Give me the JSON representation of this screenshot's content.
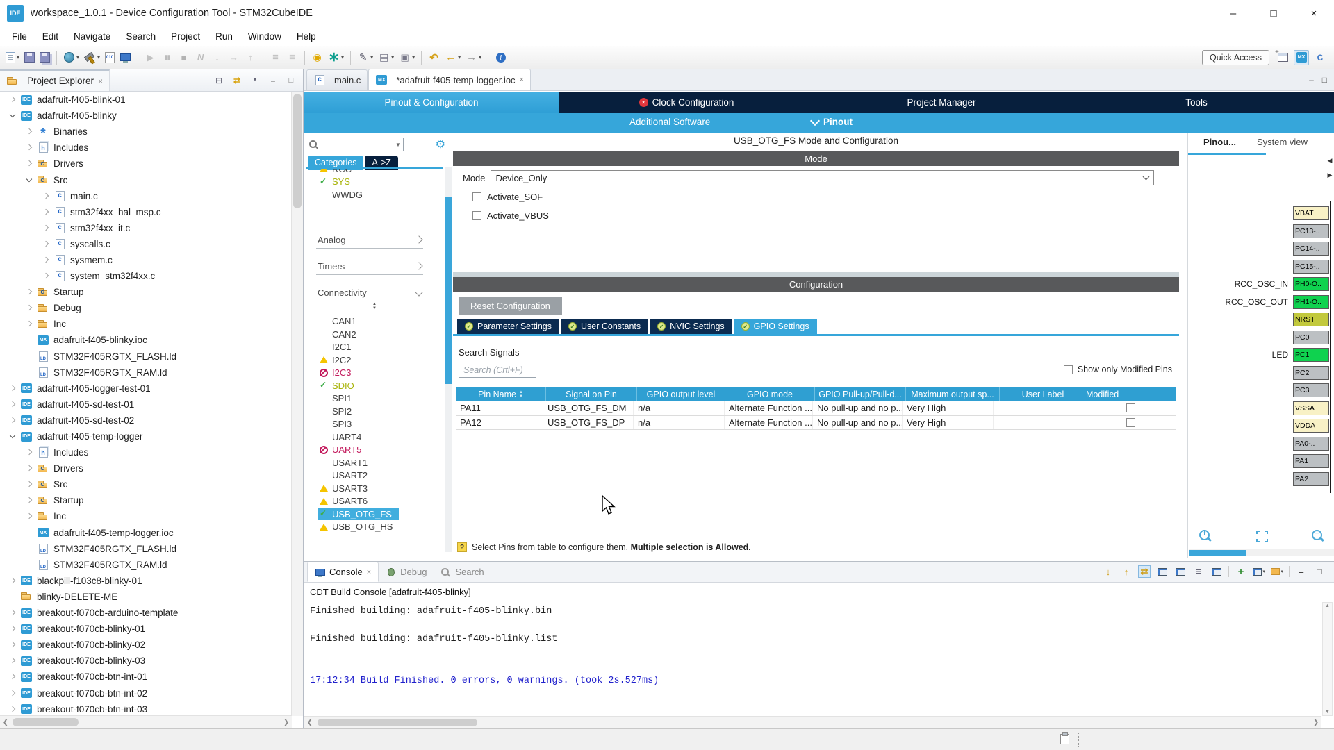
{
  "palette": {
    "accent": "#36a6da",
    "navy": "#071f3d",
    "section_header_gray": "#58595b",
    "table_header_blue": "#2f9fd2",
    "check_green": "#3fae49",
    "warning_yellow": "#f5c400",
    "blocked_pink": "#c2185b",
    "olive_enabled": "#a9b40a",
    "console_info_blue": "#2121cc",
    "pin_active_green": "#0fd24f",
    "pin_io_gray": "#bcc0c3",
    "pin_power_yellow": "#f8f1c6",
    "pin_reset_olive": "#c2c93d"
  },
  "window": {
    "title": "workspace_1.0.1 - Device Configuration Tool - STM32CubeIDE",
    "app_badge": "IDE",
    "controls": {
      "minimize": "–",
      "maximize": "□",
      "close": "×"
    }
  },
  "menu": {
    "items": [
      "File",
      "Edit",
      "Navigate",
      "Search",
      "Project",
      "Run",
      "Window",
      "Help"
    ]
  },
  "toolbar": {
    "quick_access": "Quick Access",
    "icons": [
      {
        "name": "new-wizard",
        "kind": "page",
        "dropdown": true
      },
      {
        "name": "save",
        "kind": "floppy"
      },
      {
        "name": "save-all",
        "kind": "floppy2"
      },
      {
        "kind": "sep"
      },
      {
        "name": "skip-all-breakpoints",
        "kind": "circle",
        "dropdown": true
      },
      {
        "name": "build-all",
        "kind": "hammer",
        "dropdown": true
      },
      {
        "name": "build-binary",
        "kind": "binary"
      },
      {
        "name": "open-console",
        "kind": "monitor"
      },
      {
        "kind": "sep"
      },
      {
        "name": "resume",
        "kind": "play",
        "disabled": true
      },
      {
        "name": "suspend",
        "kind": "pause",
        "disabled": true
      },
      {
        "name": "terminate",
        "kind": "stop",
        "disabled": true
      },
      {
        "name": "disconnect",
        "kind": "disconnect",
        "disabled": true
      },
      {
        "name": "step-into",
        "kind": "stepinto",
        "disabled": true
      },
      {
        "name": "step-over",
        "kind": "stepover",
        "disabled": true
      },
      {
        "name": "step-return",
        "kind": "stepreturn",
        "disabled": true
      },
      {
        "kind": "sep"
      },
      {
        "name": "instruction-stepping",
        "kind": "lines",
        "disabled": true
      },
      {
        "name": "use-step-filters",
        "kind": "lines2",
        "disabled": true
      },
      {
        "kind": "sep"
      },
      {
        "name": "update-index",
        "kind": "hand"
      },
      {
        "name": "new-launch-configuration",
        "kind": "star",
        "dropdown": true
      },
      {
        "kind": "sep"
      },
      {
        "name": "debug-tool",
        "kind": "pencil",
        "dropdown": true
      },
      {
        "name": "run-tool",
        "kind": "grid",
        "dropdown": true
      },
      {
        "name": "external-tools",
        "kind": "runext",
        "dropdown": true
      },
      {
        "kind": "sep"
      },
      {
        "name": "last-edit-location",
        "kind": "backedit"
      },
      {
        "name": "back-history",
        "kind": "back",
        "dropdown": true
      },
      {
        "name": "forward-history",
        "kind": "fwd",
        "dropdown": true
      },
      {
        "kind": "sep"
      },
      {
        "name": "help-info",
        "kind": "info"
      }
    ],
    "perspectives": [
      {
        "name": "open-perspective",
        "kind": "persp"
      },
      {
        "name": "cubemx-perspective",
        "kind": "mxp",
        "active": true
      },
      {
        "name": "cpp-perspective",
        "kind": "cpp"
      }
    ]
  },
  "explorer": {
    "title": "Project Explorer",
    "header_icons": [
      {
        "name": "collapse-all",
        "kind": "collapse"
      },
      {
        "name": "link-with-editor",
        "kind": "link"
      },
      {
        "name": "view-menu",
        "kind": "menu"
      },
      {
        "name": "minimize-view",
        "kind": "min"
      },
      {
        "name": "maximize-view",
        "kind": "max"
      }
    ],
    "tree": [
      {
        "label": "adafruit-f405-blink-01",
        "depth": 0,
        "icon": "ide",
        "chev": "collapsed"
      },
      {
        "label": "adafruit-f405-blinky",
        "depth": 0,
        "icon": "ide",
        "chev": "expanded"
      },
      {
        "label": "Binaries",
        "depth": 1,
        "icon": "bin",
        "chev": "collapsed"
      },
      {
        "label": "Includes",
        "depth": 1,
        "icon": "inc",
        "chev": "collapsed"
      },
      {
        "label": "Drivers",
        "depth": 1,
        "icon": "foldc",
        "chev": "collapsed"
      },
      {
        "label": "Src",
        "depth": 1,
        "icon": "foldc",
        "chev": "expanded"
      },
      {
        "label": "main.c",
        "depth": 2,
        "icon": "cfile",
        "chev": "collapsed"
      },
      {
        "label": "stm32f4xx_hal_msp.c",
        "depth": 2,
        "icon": "cfile",
        "chev": "collapsed"
      },
      {
        "label": "stm32f4xx_it.c",
        "depth": 2,
        "icon": "cfile",
        "chev": "collapsed"
      },
      {
        "label": "syscalls.c",
        "depth": 2,
        "icon": "cfile",
        "chev": "collapsed"
      },
      {
        "label": "sysmem.c",
        "depth": 2,
        "icon": "cfile",
        "chev": "collapsed"
      },
      {
        "label": "system_stm32f4xx.c",
        "depth": 2,
        "icon": "cfile",
        "chev": "collapsed"
      },
      {
        "label": "Startup",
        "depth": 1,
        "icon": "foldc",
        "chev": "collapsed"
      },
      {
        "label": "Debug",
        "depth": 1,
        "icon": "fold",
        "chev": "collapsed"
      },
      {
        "label": "Inc",
        "depth": 1,
        "icon": "fold",
        "chev": "collapsed"
      },
      {
        "label": "adafruit-f405-blinky.ioc",
        "depth": 1,
        "icon": "mx",
        "chev": "none"
      },
      {
        "label": "STM32F405RGTX_FLASH.ld",
        "depth": 1,
        "icon": "ld",
        "chev": "none"
      },
      {
        "label": "STM32F405RGTX_RAM.ld",
        "depth": 1,
        "icon": "ld",
        "chev": "none"
      },
      {
        "label": "adafruit-f405-logger-test-01",
        "depth": 0,
        "icon": "ide",
        "chev": "collapsed"
      },
      {
        "label": "adafruit-f405-sd-test-01",
        "depth": 0,
        "icon": "ide",
        "chev": "collapsed"
      },
      {
        "label": "adafruit-f405-sd-test-02",
        "depth": 0,
        "icon": "ide",
        "chev": "collapsed"
      },
      {
        "label": "adafruit-f405-temp-logger",
        "depth": 0,
        "icon": "ide",
        "chev": "expanded"
      },
      {
        "label": "Includes",
        "depth": 1,
        "icon": "inc",
        "chev": "collapsed"
      },
      {
        "label": "Drivers",
        "depth": 1,
        "icon": "foldc",
        "chev": "collapsed"
      },
      {
        "label": "Src",
        "depth": 1,
        "icon": "foldc",
        "chev": "collapsed"
      },
      {
        "label": "Startup",
        "depth": 1,
        "icon": "foldc",
        "chev": "collapsed"
      },
      {
        "label": "Inc",
        "depth": 1,
        "icon": "fold",
        "chev": "collapsed"
      },
      {
        "label": "adafruit-f405-temp-logger.ioc",
        "depth": 1,
        "icon": "mx",
        "chev": "none"
      },
      {
        "label": "STM32F405RGTX_FLASH.ld",
        "depth": 1,
        "icon": "ld",
        "chev": "none"
      },
      {
        "label": "STM32F405RGTX_RAM.ld",
        "depth": 1,
        "icon": "ld",
        "chev": "none"
      },
      {
        "label": "blackpill-f103c8-blinky-01",
        "depth": 0,
        "icon": "ide",
        "chev": "collapsed"
      },
      {
        "label": "blinky-DELETE-ME",
        "depth": 0,
        "icon": "fold",
        "chev": "none"
      },
      {
        "label": "breakout-f070cb-arduino-template",
        "depth": 0,
        "icon": "ide",
        "chev": "collapsed"
      },
      {
        "label": "breakout-f070cb-blinky-01",
        "depth": 0,
        "icon": "ide",
        "chev": "collapsed"
      },
      {
        "label": "breakout-f070cb-blinky-02",
        "depth": 0,
        "icon": "ide",
        "chev": "collapsed"
      },
      {
        "label": "breakout-f070cb-blinky-03",
        "depth": 0,
        "icon": "ide",
        "chev": "collapsed"
      },
      {
        "label": "breakout-f070cb-btn-int-01",
        "depth": 0,
        "icon": "ide",
        "chev": "collapsed"
      },
      {
        "label": "breakout-f070cb-btn-int-02",
        "depth": 0,
        "icon": "ide",
        "chev": "collapsed"
      },
      {
        "label": "breakout-f070cb-btn-int-03",
        "depth": 0,
        "icon": "ide",
        "chev": "collapsed"
      }
    ]
  },
  "editor": {
    "tabs": [
      {
        "label": "main.c",
        "icon": "cfile",
        "active": false
      },
      {
        "label": "*adafruit-f405-temp-logger.ioc",
        "icon": "mx",
        "active": true,
        "closable": true
      }
    ]
  },
  "cube": {
    "nav_tabs": [
      {
        "label": "Pinout & Configuration",
        "active": true
      },
      {
        "label": "Clock Configuration",
        "error": true
      },
      {
        "label": "Project Manager"
      },
      {
        "label": "Tools"
      }
    ],
    "software_bar": {
      "additional": "Additional Software",
      "pinout": "Pinout"
    },
    "periph": {
      "tabs": [
        {
          "label": "Categories",
          "active": true
        },
        {
          "label": "A->Z",
          "active": false
        }
      ],
      "items": [
        {
          "type": "item",
          "label": "RCC",
          "status": "warning",
          "clipped": true
        },
        {
          "type": "item",
          "label": "SYS",
          "status": "check",
          "accent": "olive"
        },
        {
          "type": "item",
          "label": "WWDG",
          "status": "none"
        },
        {
          "type": "section",
          "label": "Analog",
          "chev": "right",
          "gap": "large"
        },
        {
          "type": "section",
          "label": "Timers",
          "chev": "right"
        },
        {
          "type": "section",
          "label": "Connectivity",
          "chev": "down"
        },
        {
          "type": "scrollhint"
        },
        {
          "type": "item",
          "label": "CAN1",
          "status": "none"
        },
        {
          "type": "item",
          "label": "CAN2",
          "status": "none"
        },
        {
          "type": "item",
          "label": "I2C1",
          "status": "none"
        },
        {
          "type": "item",
          "label": "I2C2",
          "status": "warning"
        },
        {
          "type": "item",
          "label": "I2C3",
          "status": "blocked"
        },
        {
          "type": "item",
          "label": "SDIO",
          "status": "check",
          "accent": "olive"
        },
        {
          "type": "item",
          "label": "SPI1",
          "status": "none"
        },
        {
          "type": "item",
          "label": "SPI2",
          "status": "none"
        },
        {
          "type": "item",
          "label": "SPI3",
          "status": "none"
        },
        {
          "type": "item",
          "label": "UART4",
          "status": "none"
        },
        {
          "type": "item",
          "label": "UART5",
          "status": "blocked"
        },
        {
          "type": "item",
          "label": "USART1",
          "status": "none"
        },
        {
          "type": "item",
          "label": "USART2",
          "status": "none"
        },
        {
          "type": "item",
          "label": "USART3",
          "status": "warning"
        },
        {
          "type": "item",
          "label": "USART6",
          "status": "warning"
        },
        {
          "type": "item",
          "label": "USB_OTG_FS",
          "status": "check",
          "selected": true
        },
        {
          "type": "item",
          "label": "USB_OTG_HS",
          "status": "warning"
        }
      ]
    },
    "mode": {
      "title": "USB_OTG_FS Mode and Configuration",
      "section": "Mode",
      "label": "Mode",
      "value": "Device_Only",
      "options": [
        {
          "label": "Activate_SOF",
          "checked": false
        },
        {
          "label": "Activate_VBUS",
          "checked": false
        }
      ]
    },
    "config": {
      "section": "Configuration",
      "reset_label": "Reset Configuration",
      "tabs": [
        {
          "label": "Parameter Settings"
        },
        {
          "label": "User Constants"
        },
        {
          "label": "NVIC Settings"
        },
        {
          "label": "GPIO Settings",
          "active": true
        }
      ],
      "search_label": "Search Signals",
      "search_placeholder": "Search (Crtl+F)",
      "show_modified": "Show only Modified Pins",
      "table": {
        "columns": [
          {
            "label": "Pin Name",
            "sort": true
          },
          {
            "label": "Signal on Pin"
          },
          {
            "label": "GPIO output level"
          },
          {
            "label": "GPIO mode"
          },
          {
            "label": "GPIO Pull-up/Pull-d..."
          },
          {
            "label": "Maximum output sp..."
          },
          {
            "label": "User Label"
          },
          {
            "label": "Modified"
          }
        ],
        "rows": [
          {
            "pin": "PA11",
            "signal": "USB_OTG_FS_DM",
            "level": "n/a",
            "mode": "Alternate Function ...",
            "pull": "No pull-up and no p...",
            "speed": "Very High",
            "user_label": "",
            "modified": false
          },
          {
            "pin": "PA12",
            "signal": "USB_OTG_FS_DP",
            "level": "n/a",
            "mode": "Alternate Function ...",
            "pull": "No pull-up and no p...",
            "speed": "Very High",
            "user_label": "",
            "modified": false
          }
        ]
      },
      "hint_normal": "Select Pins from table to configure them. ",
      "hint_bold": "Multiple selection is Allowed."
    },
    "pinout_view": {
      "tabs": [
        {
          "label": "Pinou...",
          "icon": "chip",
          "active": true
        },
        {
          "label": "System view",
          "icon": "sys"
        }
      ],
      "pins": [
        {
          "name": "VBAT",
          "kind": "power"
        },
        {
          "name": "PC13-..",
          "kind": "io"
        },
        {
          "name": "PC14-..",
          "kind": "io"
        },
        {
          "name": "PC15-..",
          "kind": "io"
        },
        {
          "name": "PH0-O..",
          "kind": "active",
          "signal": "RCC_OSC_IN"
        },
        {
          "name": "PH1-O..",
          "kind": "active",
          "signal": "RCC_OSC_OUT"
        },
        {
          "name": "NRST",
          "kind": "reset"
        },
        {
          "name": "PC0",
          "kind": "io"
        },
        {
          "name": "PC1",
          "kind": "active",
          "signal": "LED"
        },
        {
          "name": "PC2",
          "kind": "io"
        },
        {
          "name": "PC3",
          "kind": "io"
        },
        {
          "name": "VSSA",
          "kind": "power"
        },
        {
          "name": "VDDA",
          "kind": "power"
        },
        {
          "name": "PA0-..",
          "kind": "io"
        },
        {
          "name": "PA1",
          "kind": "io"
        },
        {
          "name": "PA2",
          "kind": "io"
        }
      ]
    }
  },
  "console": {
    "tabs": [
      {
        "label": "Console",
        "icon": "console",
        "active": true,
        "closable": true
      },
      {
        "label": "Debug",
        "icon": "debug"
      },
      {
        "label": "Search",
        "icon": "search"
      }
    ],
    "subtitle": "CDT Build Console [adafruit-f405-blinky]",
    "lines": [
      {
        "text": "Finished building: adafruit-f405-blinky.bin"
      },
      {
        "text": ""
      },
      {
        "text": "Finished building: adafruit-f405-blinky.list"
      },
      {
        "text": ""
      },
      {
        "text": ""
      },
      {
        "text": "17:12:34 Build Finished. 0 errors, 0 warnings. (took 2s.527ms)",
        "color": "#2121cc"
      }
    ],
    "icons": [
      {
        "name": "scroll-down",
        "kind": "arrdown"
      },
      {
        "name": "scroll-up",
        "kind": "arrup"
      },
      {
        "name": "scroll-lock",
        "kind": "swap",
        "active": true
      },
      {
        "name": "show-console-stdout",
        "kind": "mon1"
      },
      {
        "name": "show-console-stderr",
        "kind": "mon2"
      },
      {
        "name": "word-wrap",
        "kind": "lines"
      },
      {
        "name": "clear-console",
        "kind": "monx"
      },
      {
        "kind": "sep"
      },
      {
        "name": "pin-console",
        "kind": "pin"
      },
      {
        "name": "display-selected-console",
        "kind": "mondd",
        "dropdown": true
      },
      {
        "name": "open-console-view",
        "kind": "folder",
        "dropdown": true
      },
      {
        "kind": "sep"
      },
      {
        "name": "minimize-view",
        "kind": "min"
      },
      {
        "name": "maximize-view",
        "kind": "max"
      }
    ]
  }
}
